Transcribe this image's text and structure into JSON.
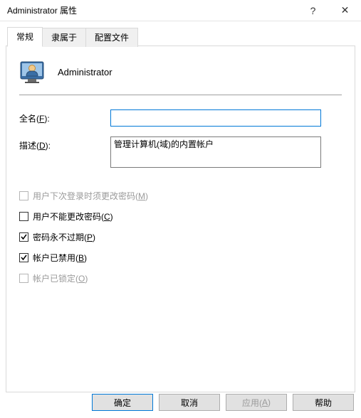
{
  "window": {
    "title": "Administrator 属性",
    "help": "?",
    "close": "✕"
  },
  "tabs": {
    "general": "常规",
    "member": "隶属于",
    "profile": "配置文件"
  },
  "header": {
    "username": "Administrator"
  },
  "fields": {
    "fullname_label": "全名(",
    "fullname_key": "F",
    "fullname_suffix": "):",
    "fullname_value": "",
    "description_label": "描述(",
    "description_key": "D",
    "description_suffix": "):",
    "description_value": "管理计算机(域)的内置帐户"
  },
  "checkboxes": {
    "must_change_label": "用户下次登录时须更改密码(",
    "must_change_key": "M",
    "must_change_suffix": ")",
    "must_change_checked": false,
    "must_change_enabled": false,
    "cannot_change_label": "用户不能更改密码(",
    "cannot_change_key": "C",
    "cannot_change_suffix": ")",
    "cannot_change_checked": false,
    "never_expires_label": "密码永不过期(",
    "never_expires_key": "P",
    "never_expires_suffix": ")",
    "never_expires_checked": true,
    "disabled_label": "帐户已禁用(",
    "disabled_key": "B",
    "disabled_suffix": ")",
    "disabled_checked": true,
    "locked_label": "帐户已锁定(",
    "locked_key": "O",
    "locked_suffix": ")",
    "locked_checked": false,
    "locked_enabled": false
  },
  "buttons": {
    "ok": "确定",
    "cancel": "取消",
    "apply_label": "应用(",
    "apply_key": "A",
    "apply_suffix": ")",
    "help": "帮助"
  }
}
